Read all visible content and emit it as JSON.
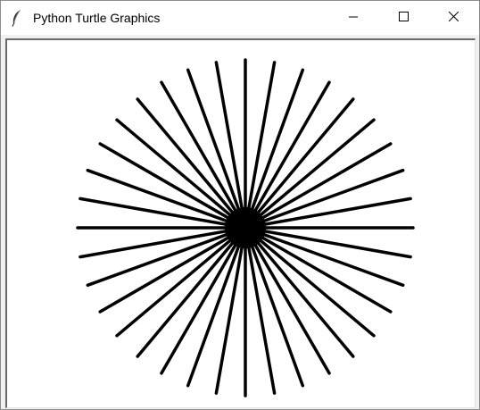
{
  "window": {
    "title": "Python Turtle Graphics",
    "icon": "feather-icon",
    "controls": [
      "minimize-icon",
      "maximize-icon",
      "close-icon"
    ]
  },
  "drawing": {
    "shape": "starburst",
    "ray_count": 36,
    "ray_step_degrees": 10,
    "ray_color": "#000000",
    "center_fill": "#000000",
    "background": "#ffffff"
  }
}
